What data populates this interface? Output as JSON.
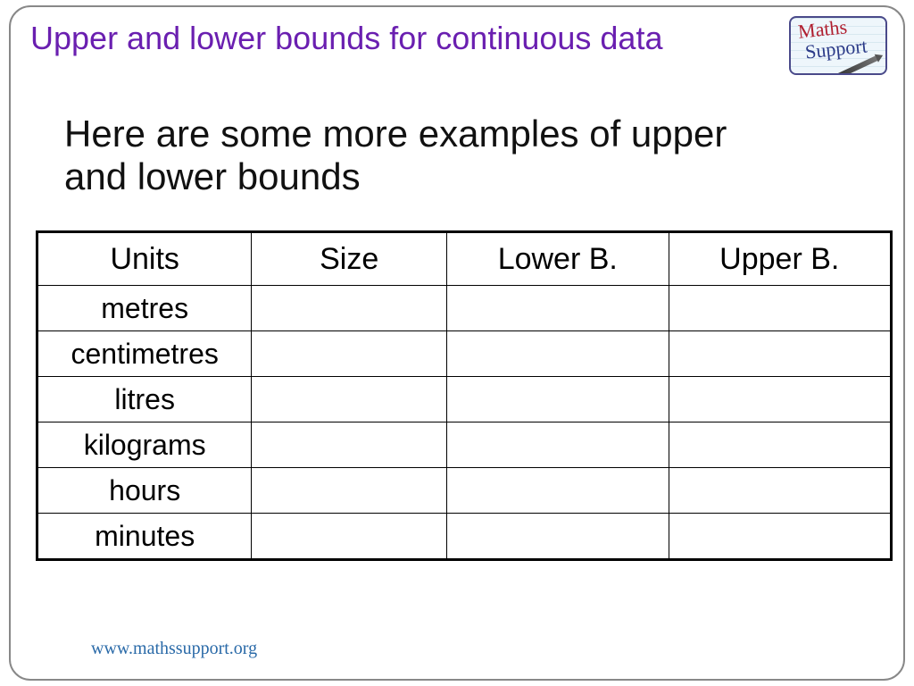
{
  "title": "Upper and lower bounds for continuous data",
  "logo": {
    "line1": "Maths",
    "line2": "Support"
  },
  "intro": "Here are some more examples of upper and lower bounds",
  "table": {
    "headers": {
      "units": "Units",
      "size": "Size",
      "lower": "Lower B.",
      "upper": "Upper B."
    },
    "rows": [
      {
        "units": "metres",
        "size": "",
        "lower": "",
        "upper": ""
      },
      {
        "units": "centimetres",
        "size": "",
        "lower": "",
        "upper": ""
      },
      {
        "units": "litres",
        "size": "",
        "lower": "",
        "upper": ""
      },
      {
        "units": "kilograms",
        "size": "",
        "lower": "",
        "upper": ""
      },
      {
        "units": "hours",
        "size": "",
        "lower": "",
        "upper": ""
      },
      {
        "units": "minutes",
        "size": "",
        "lower": "",
        "upper": ""
      }
    ]
  },
  "footer": {
    "url": "www.mathssupport.org"
  }
}
